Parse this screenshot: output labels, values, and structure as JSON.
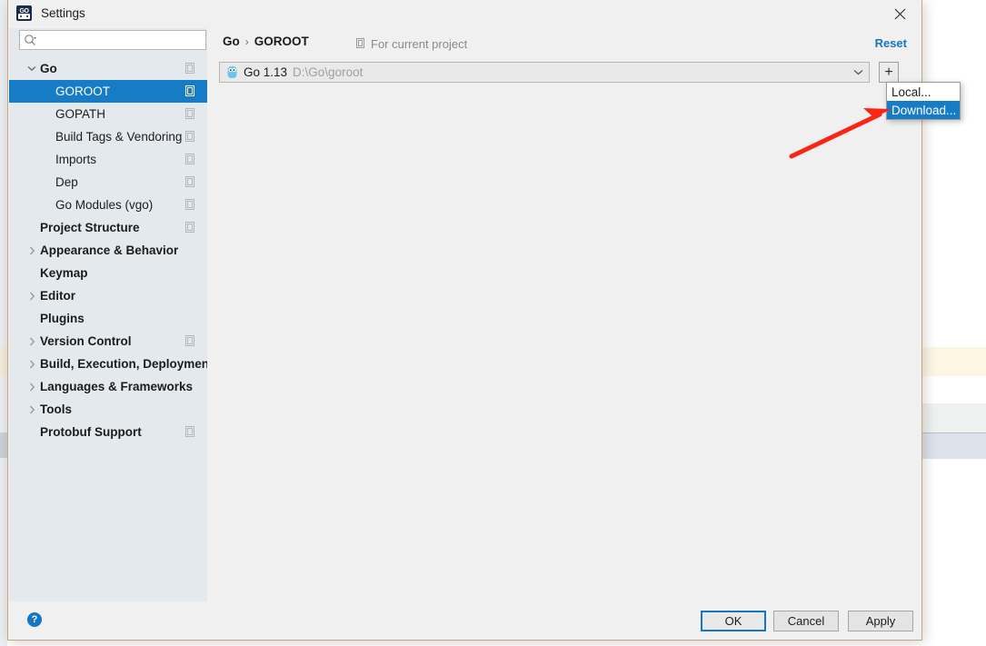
{
  "window": {
    "title": "Settings",
    "app_icon": "goland-icon",
    "close_label": "×"
  },
  "search": {
    "value": "",
    "placeholder": "",
    "icon": "search-icon"
  },
  "sidebar": {
    "items": [
      {
        "label": "Go",
        "level": 0,
        "bold": true,
        "arrow": "down",
        "selected": false,
        "badge": true
      },
      {
        "label": "GOROOT",
        "level": 1,
        "bold": false,
        "arrow": "",
        "selected": true,
        "badge": true
      },
      {
        "label": "GOPATH",
        "level": 1,
        "bold": false,
        "arrow": "",
        "selected": false,
        "badge": true
      },
      {
        "label": "Build Tags & Vendoring",
        "level": 1,
        "bold": false,
        "arrow": "",
        "selected": false,
        "badge": true
      },
      {
        "label": "Imports",
        "level": 1,
        "bold": false,
        "arrow": "",
        "selected": false,
        "badge": true
      },
      {
        "label": "Dep",
        "level": 1,
        "bold": false,
        "arrow": "",
        "selected": false,
        "badge": true
      },
      {
        "label": "Go Modules (vgo)",
        "level": 1,
        "bold": false,
        "arrow": "",
        "selected": false,
        "badge": true
      },
      {
        "label": "Project Structure",
        "level": 0,
        "bold": true,
        "arrow": "",
        "selected": false,
        "badge": true
      },
      {
        "label": "Appearance & Behavior",
        "level": 0,
        "bold": true,
        "arrow": "right",
        "selected": false,
        "badge": false
      },
      {
        "label": "Keymap",
        "level": 0,
        "bold": true,
        "arrow": "",
        "selected": false,
        "badge": false
      },
      {
        "label": "Editor",
        "level": 0,
        "bold": true,
        "arrow": "right",
        "selected": false,
        "badge": false
      },
      {
        "label": "Plugins",
        "level": 0,
        "bold": true,
        "arrow": "",
        "selected": false,
        "badge": false
      },
      {
        "label": "Version Control",
        "level": 0,
        "bold": true,
        "arrow": "right",
        "selected": false,
        "badge": true
      },
      {
        "label": "Build, Execution, Deployment",
        "level": 0,
        "bold": true,
        "arrow": "right",
        "selected": false,
        "badge": false
      },
      {
        "label": "Languages & Frameworks",
        "level": 0,
        "bold": true,
        "arrow": "right",
        "selected": false,
        "badge": false
      },
      {
        "label": "Tools",
        "level": 0,
        "bold": true,
        "arrow": "right",
        "selected": false,
        "badge": false
      },
      {
        "label": "Protobuf Support",
        "level": 0,
        "bold": true,
        "arrow": "",
        "selected": false,
        "badge": true
      }
    ]
  },
  "content": {
    "breadcrumb_root": "Go",
    "breadcrumb_separator": "›",
    "breadcrumb_current": "GOROOT",
    "for_current_project": "For current project",
    "for_current_project_icon": "project-scope-icon",
    "reset_label": "Reset",
    "goroot": {
      "icon": "gopher-icon",
      "name": "Go 1.13",
      "path": "D:\\Go\\goroot",
      "dropdown_icon": "chevron-down-icon"
    },
    "add_button_label": "+"
  },
  "popup": {
    "items": [
      {
        "label": "Local...",
        "highlighted": false
      },
      {
        "label": "Download...",
        "highlighted": true
      }
    ]
  },
  "footer": {
    "help_label": "?",
    "ok_label": "OK",
    "cancel_label": "Cancel",
    "apply_label": "Apply"
  },
  "colors": {
    "accent_blue": "#177cc6",
    "link_blue": "#1576c4",
    "sidebar_bg": "#e4e9ed",
    "panel_bg": "#f0f0f0",
    "window_border": "#c8a878",
    "annotation_red": "#fb2516"
  },
  "annotation": {
    "arrow": "red-arrow-pointing-to-download"
  }
}
